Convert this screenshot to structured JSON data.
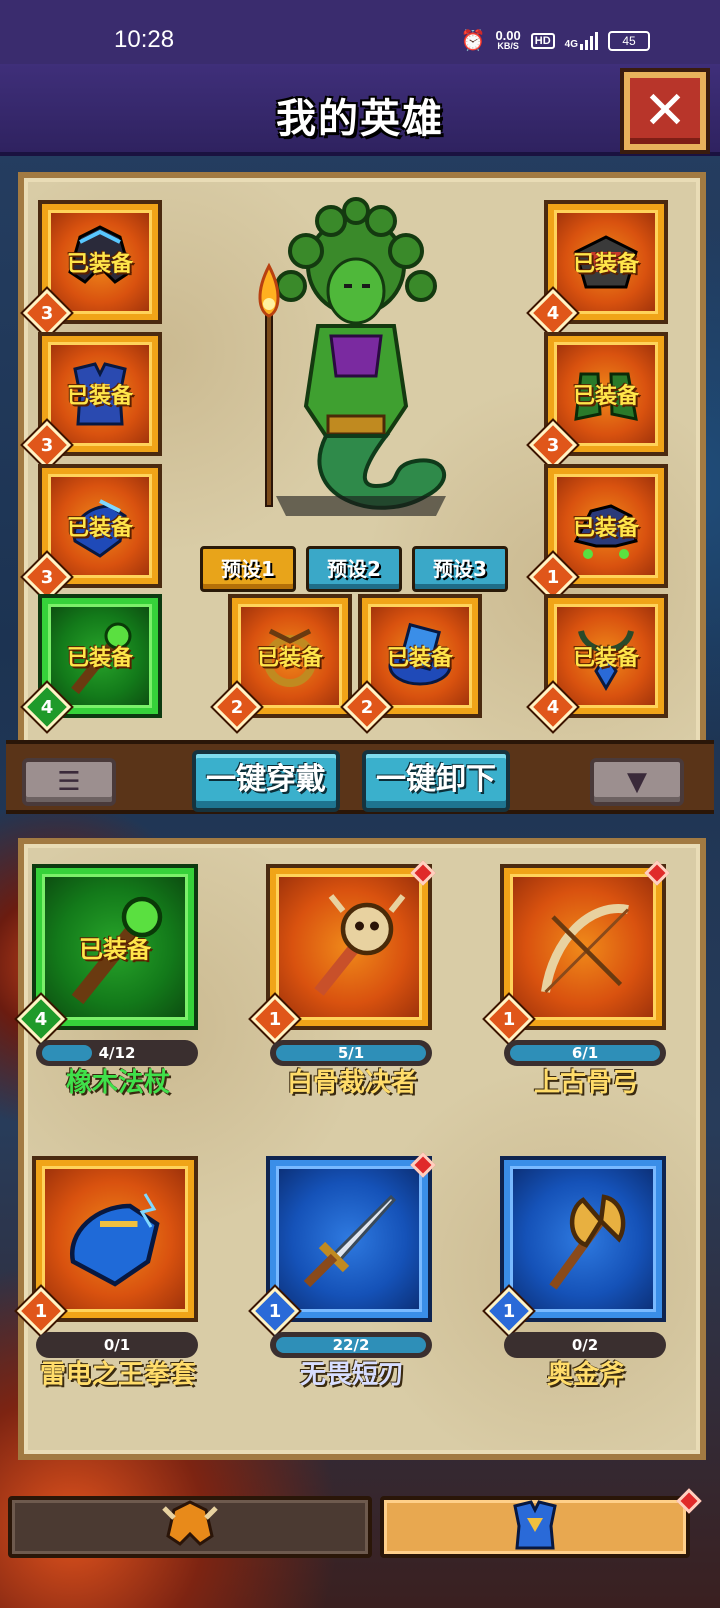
{
  "status_bar": {
    "time": "10:28",
    "net_speed": "0.00",
    "net_unit": "KB/S",
    "hd": "HD",
    "signal": "4G",
    "battery": "45"
  },
  "header": {
    "title": "我的英雄",
    "close_label": "✕"
  },
  "equip_slots": [
    {
      "name": "helmet",
      "status": "已装备",
      "level": "3",
      "rarity": "orange"
    },
    {
      "name": "armor",
      "status": "已装备",
      "level": "3",
      "rarity": "orange"
    },
    {
      "name": "gauntlet",
      "status": "已装备",
      "level": "3",
      "rarity": "orange"
    },
    {
      "name": "weapon",
      "status": "已装备",
      "level": "4",
      "rarity": "green"
    },
    {
      "name": "shoulder",
      "status": "已装备",
      "level": "4",
      "rarity": "orange"
    },
    {
      "name": "boots",
      "status": "已装备",
      "level": "3",
      "rarity": "orange"
    },
    {
      "name": "mount",
      "status": "已装备",
      "level": "1",
      "rarity": "orange"
    },
    {
      "name": "amulet",
      "status": "已装备",
      "level": "4",
      "rarity": "orange"
    },
    {
      "name": "ring",
      "status": "已装备",
      "level": "2",
      "rarity": "orange"
    },
    {
      "name": "book",
      "status": "已装备",
      "level": "2",
      "rarity": "orange"
    }
  ],
  "presets": [
    "预设1",
    "预设2",
    "预设3"
  ],
  "toolbar": {
    "list_icon": "list-icon",
    "equip_all": "一键穿戴",
    "unequip_all": "一键卸下",
    "filter_icon": "filter-icon"
  },
  "inventory": [
    {
      "name": "橡木法杖",
      "status": "已装备",
      "level": "4",
      "progress": "4/12",
      "fill": 0.33,
      "rarity": "green",
      "alert": false
    },
    {
      "name": "白骨裁决者",
      "status": "",
      "level": "1",
      "progress": "5/1",
      "fill": 1.0,
      "rarity": "orange",
      "alert": true
    },
    {
      "name": "上古骨弓",
      "status": "",
      "level": "1",
      "progress": "6/1",
      "fill": 1.0,
      "rarity": "orange",
      "alert": true
    },
    {
      "name": "雷电之王拳套",
      "status": "",
      "level": "1",
      "progress": "0/1",
      "fill": 0.0,
      "rarity": "orange",
      "alert": false
    },
    {
      "name": "无畏短刃",
      "status": "",
      "level": "1",
      "progress": "22/2",
      "fill": 1.0,
      "rarity": "blue",
      "alert": true
    },
    {
      "name": "奥金斧",
      "status": "",
      "level": "1",
      "progress": "0/2",
      "fill": 0.0,
      "rarity": "blue",
      "alert": false
    }
  ],
  "bottom_nav": [
    {
      "name": "hero-tab",
      "icon": "helmet-icon",
      "active": false
    },
    {
      "name": "equipment-tab",
      "icon": "armor-icon",
      "active": true
    }
  ]
}
